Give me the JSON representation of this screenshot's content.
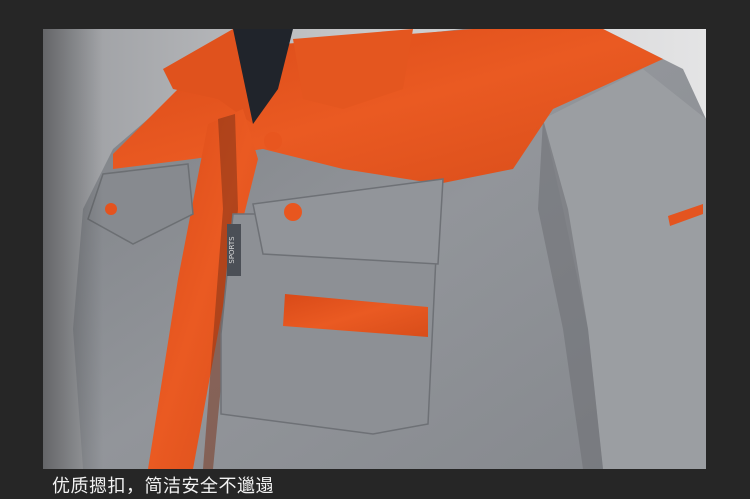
{
  "caption": "优质摁扣，简洁安全不邋遢",
  "tag_text": "SPORTS",
  "colors": {
    "background": "#262626",
    "jacket_gray": "#8f9296",
    "jacket_orange": "#e8551f",
    "caption_text": "#f2f2f2"
  }
}
